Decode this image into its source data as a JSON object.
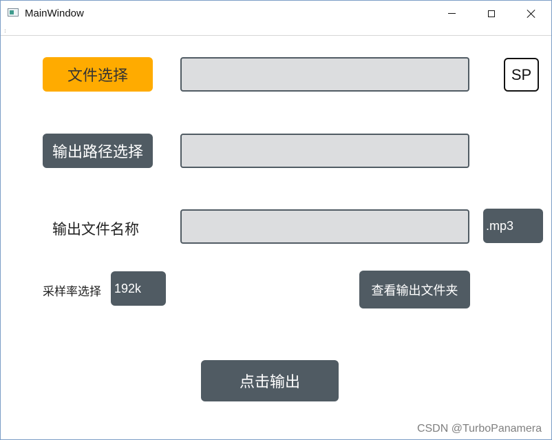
{
  "window": {
    "title": "MainWindow",
    "grip": ":"
  },
  "buttons": {
    "file_select": "文件选择",
    "output_path_select": "输出路径选择",
    "sp": "SP",
    "extension": ".mp3",
    "samplerate_value": "192k",
    "open_output_folder": "查看输出文件夹",
    "export": "点击输出"
  },
  "labels": {
    "output_file_name": "输出文件名称",
    "samplerate": "采样率选择"
  },
  "fields": {
    "file_path": "",
    "output_path": "",
    "output_file_name": ""
  },
  "watermark": "CSDN @TurboPanamera",
  "colors": {
    "accent_orange": "#ffab00",
    "dark_button": "#505b63",
    "field_bg": "#dcdddf"
  }
}
